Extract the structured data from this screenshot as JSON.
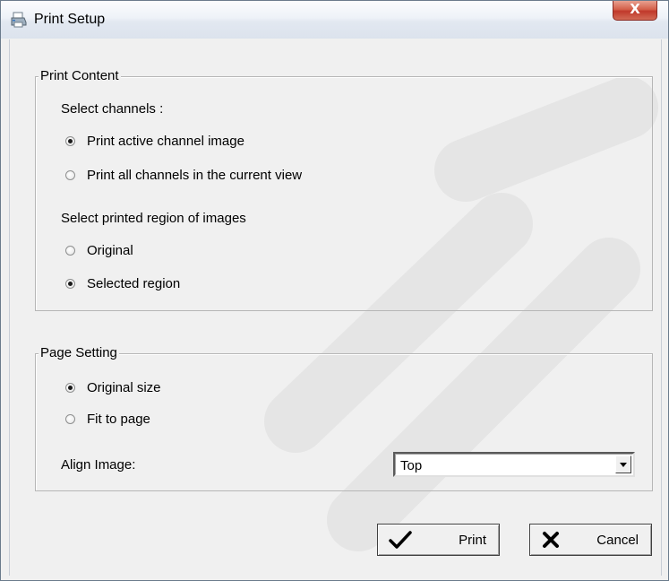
{
  "window": {
    "title": "Print Setup",
    "close_label": "X"
  },
  "print_content": {
    "legend": "Print Content",
    "select_channels_label": "Select channels :",
    "channel_options": [
      {
        "label": "Print active channel image",
        "checked": true
      },
      {
        "label": "Print all channels in the current view",
        "checked": false
      }
    ],
    "region_label": "Select printed region of images",
    "region_options": [
      {
        "label": "Original",
        "checked": false
      },
      {
        "label": "Selected region",
        "checked": true
      }
    ]
  },
  "page_setting": {
    "legend": "Page Setting",
    "size_options": [
      {
        "label": "Original size",
        "checked": true
      },
      {
        "label": "Fit to page",
        "checked": false
      }
    ],
    "align_label": "Align Image:",
    "align_value": "Top"
  },
  "buttons": {
    "print_label": "Print",
    "cancel_label": "Cancel"
  },
  "icons": {
    "title": "printer-icon",
    "print": "checkmark-icon",
    "cancel": "x-icon"
  }
}
